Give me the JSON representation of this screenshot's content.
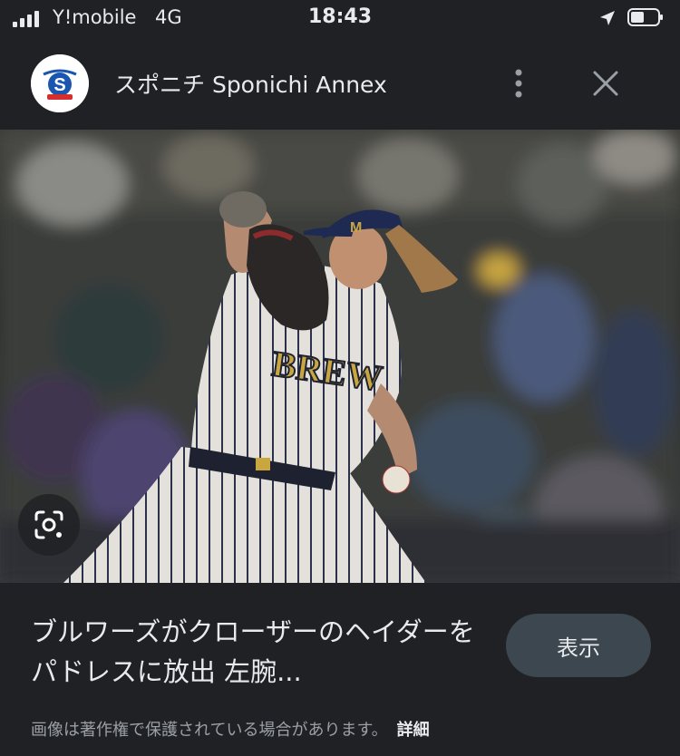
{
  "status_bar": {
    "carrier": "Y!mobile",
    "network": "4G",
    "time": "18:43",
    "icons": [
      "signal-bars-icon",
      "location-arrow-icon",
      "battery-icon"
    ]
  },
  "header": {
    "site_name": "スポニチ Sponichi Annex",
    "logo_icon": "sponichi-logo-icon",
    "more_icon": "more-vert-icon",
    "close_icon": "close-icon"
  },
  "image": {
    "description_icon": "baseball-pitcher-photo",
    "jersey_text": "BREW",
    "lens_icon": "google-lens-icon"
  },
  "caption": {
    "title": "ブルワーズがクローザーのヘイダーをパドレスに放出 左腕...",
    "view_button": "表示",
    "copyright_notice": "画像は著作権で保護されている場合があります。",
    "details_link": "詳細"
  },
  "colors": {
    "background": "#202124",
    "button_bg": "#3c4750",
    "text_primary": "#e8eaed",
    "text_secondary": "#9aa0a6",
    "logo_blue": "#1a56b0",
    "logo_red": "#d32f2f"
  }
}
